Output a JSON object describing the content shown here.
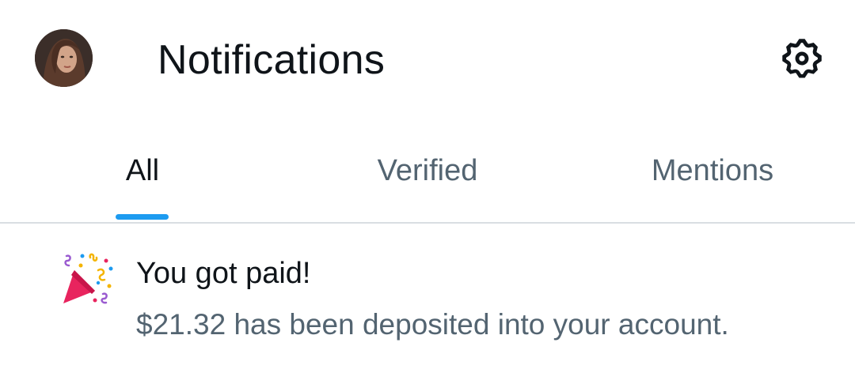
{
  "header": {
    "title": "Notifications",
    "avatar_icon": "user-avatar",
    "settings_icon": "gear-icon"
  },
  "tabs": [
    {
      "label": "All",
      "active": true
    },
    {
      "label": "Verified",
      "active": false
    },
    {
      "label": "Mentions",
      "active": false
    }
  ],
  "notifications": [
    {
      "icon": "party-popper-icon",
      "title": "You got paid!",
      "body": "$21.32 has been deposited into your account."
    }
  ],
  "colors": {
    "accent": "#1d9bf0",
    "primary_text": "#0f1419",
    "secondary_text": "#536471",
    "divider": "#d9dee2"
  }
}
